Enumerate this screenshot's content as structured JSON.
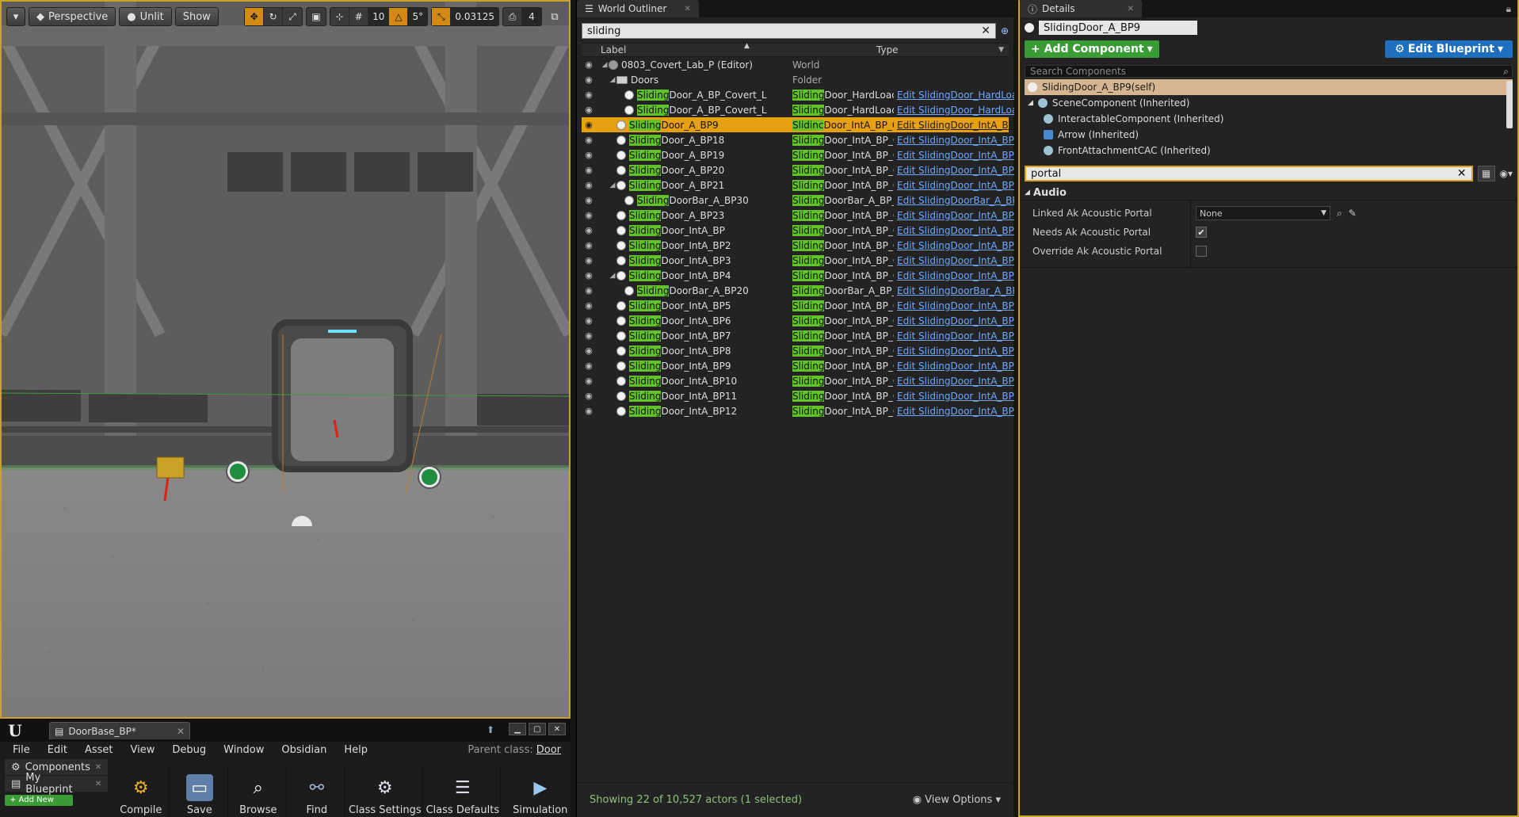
{
  "viewport": {
    "toolbar": {
      "view_mode": "Perspective",
      "lighting": "Unlit",
      "show": "Show",
      "grid_snap": "10",
      "rot_snap": "5°",
      "scale_snap": "0.03125",
      "cam_speed": "4"
    },
    "accent": "#d38a12"
  },
  "bp_editor": {
    "tab_title": "DoorBase_BP*",
    "menu": [
      "File",
      "Edit",
      "Asset",
      "View",
      "Debug",
      "Window",
      "Obsidian",
      "Help"
    ],
    "parent_class_label": "Parent class:",
    "parent_class_value": "Door",
    "left_panels": [
      "Components",
      "My Blueprint"
    ],
    "add_new": "+ Add New",
    "toolbar": [
      "Compile",
      "Save",
      "Browse",
      "Find",
      "Class Settings",
      "Class Defaults",
      "Simulation"
    ]
  },
  "outliner": {
    "tab": "World Outliner",
    "search": "sliding",
    "col_label": "Label",
    "col_type": "Type",
    "footer": "Showing 22 of 10,527 actors (1 selected)",
    "view_options": "View Options",
    "highlight": "#62c22a",
    "rows": [
      {
        "indent": 0,
        "tri": "◢",
        "icon": "world",
        "pre": "",
        "hl": "",
        "post": "0803_Covert_Lab_P (Editor)",
        "t_hl": "",
        "t_post": "",
        "type_plain": "World",
        "edit": ""
      },
      {
        "indent": 1,
        "tri": "◢",
        "icon": "folder",
        "pre": "",
        "hl": "",
        "post": "Doors",
        "t_hl": "",
        "t_post": "",
        "type_plain": "Folder",
        "edit": ""
      },
      {
        "indent": 2,
        "tri": "",
        "icon": "actor",
        "pre": "",
        "hl": "Sliding",
        "post": "Door_A_BP_Covert_L",
        "t_hl": "Sliding",
        "t_post": "Door_HardLoad_BP_C",
        "type_plain": "",
        "edit": "Edit SlidingDoor_HardLoa"
      },
      {
        "indent": 2,
        "tri": "",
        "icon": "actor",
        "pre": "",
        "hl": "Sliding",
        "post": "Door_A_BP_Covert_L",
        "t_hl": "Sliding",
        "t_post": "Door_HardLoad_BP_C",
        "type_plain": "",
        "edit": "Edit SlidingDoor_HardLoa"
      },
      {
        "indent": 1,
        "tri": "",
        "icon": "actor",
        "pre": "",
        "hl": "Sliding",
        "post": "Door_A_BP9",
        "t_hl": "Slidinc",
        "t_post": "Door_IntA_BP_C",
        "type_plain": "",
        "edit": "Edit SlidingDoor_IntA_BP",
        "selected": true
      },
      {
        "indent": 1,
        "tri": "",
        "icon": "actor",
        "pre": "",
        "hl": "Sliding",
        "post": "Door_A_BP18",
        "t_hl": "Sliding",
        "t_post": "Door_IntA_BP_C",
        "type_plain": "",
        "edit": "Edit SlidingDoor_IntA_BP"
      },
      {
        "indent": 1,
        "tri": "",
        "icon": "actor",
        "pre": "",
        "hl": "Sliding",
        "post": "Door_A_BP19",
        "t_hl": "Sliding",
        "t_post": "Door_IntA_BP_C",
        "type_plain": "",
        "edit": "Edit SlidingDoor_IntA_BP"
      },
      {
        "indent": 1,
        "tri": "",
        "icon": "actor",
        "pre": "",
        "hl": "Sliding",
        "post": "Door_A_BP20",
        "t_hl": "Sliding",
        "t_post": "Door_IntA_BP_C",
        "type_plain": "",
        "edit": "Edit SlidingDoor_IntA_BP"
      },
      {
        "indent": 1,
        "tri": "◢",
        "icon": "actor",
        "pre": "",
        "hl": "Sliding",
        "post": "Door_A_BP21",
        "t_hl": "Sliding",
        "t_post": "Door_IntA_BP_C",
        "type_plain": "",
        "edit": "Edit SlidingDoor_IntA_BP"
      },
      {
        "indent": 2,
        "tri": "",
        "icon": "actor",
        "pre": "",
        "hl": "Sliding",
        "post": "DoorBar_A_BP30",
        "t_hl": "Sliding",
        "t_post": "DoorBar_A_BP_C",
        "type_plain": "",
        "edit": "Edit SlidingDoorBar_A_BP"
      },
      {
        "indent": 1,
        "tri": "",
        "icon": "actor",
        "pre": "",
        "hl": "Sliding",
        "post": "Door_A_BP23",
        "t_hl": "Sliding",
        "t_post": "Door_IntA_BP_C",
        "type_plain": "",
        "edit": "Edit SlidingDoor_IntA_BP"
      },
      {
        "indent": 1,
        "tri": "",
        "icon": "actor",
        "pre": "",
        "hl": "Sliding",
        "post": "Door_IntA_BP",
        "t_hl": "Sliding",
        "t_post": "Door_IntA_BP_C",
        "type_plain": "",
        "edit": "Edit SlidingDoor_IntA_BP"
      },
      {
        "indent": 1,
        "tri": "",
        "icon": "actor",
        "pre": "",
        "hl": "Sliding",
        "post": "Door_IntA_BP2",
        "t_hl": "Sliding",
        "t_post": "Door_IntA_BP_C",
        "type_plain": "",
        "edit": "Edit SlidingDoor_IntA_BP"
      },
      {
        "indent": 1,
        "tri": "",
        "icon": "actor",
        "pre": "",
        "hl": "Sliding",
        "post": "Door_IntA_BP3",
        "t_hl": "Sliding",
        "t_post": "Door_IntA_BP_C",
        "type_plain": "",
        "edit": "Edit SlidingDoor_IntA_BP"
      },
      {
        "indent": 1,
        "tri": "◢",
        "icon": "actor",
        "pre": "",
        "hl": "Sliding",
        "post": "Door_IntA_BP4",
        "t_hl": "Sliding",
        "t_post": "Door_IntA_BP_C",
        "type_plain": "",
        "edit": "Edit SlidingDoor_IntA_BP"
      },
      {
        "indent": 2,
        "tri": "",
        "icon": "actor",
        "pre": "",
        "hl": "Sliding",
        "post": "DoorBar_A_BP20",
        "t_hl": "Sliding",
        "t_post": "DoorBar_A_BP_C",
        "type_plain": "",
        "edit": "Edit SlidingDoorBar_A_BP"
      },
      {
        "indent": 1,
        "tri": "",
        "icon": "actor",
        "pre": "",
        "hl": "Sliding",
        "post": "Door_IntA_BP5",
        "t_hl": "Sliding",
        "t_post": "Door_IntA_BP_C",
        "type_plain": "",
        "edit": "Edit SlidingDoor_IntA_BP"
      },
      {
        "indent": 1,
        "tri": "",
        "icon": "actor",
        "pre": "",
        "hl": "Sliding",
        "post": "Door_IntA_BP6",
        "t_hl": "Sliding",
        "t_post": "Door_IntA_BP_C",
        "type_plain": "",
        "edit": "Edit SlidingDoor_IntA_BP"
      },
      {
        "indent": 1,
        "tri": "",
        "icon": "actor",
        "pre": "",
        "hl": "Sliding",
        "post": "Door_IntA_BP7",
        "t_hl": "Sliding",
        "t_post": "Door_IntA_BP_C",
        "type_plain": "",
        "edit": "Edit SlidingDoor_IntA_BP"
      },
      {
        "indent": 1,
        "tri": "",
        "icon": "actor",
        "pre": "",
        "hl": "Sliding",
        "post": "Door_IntA_BP8",
        "t_hl": "Sliding",
        "t_post": "Door_IntA_BP_C",
        "type_plain": "",
        "edit": "Edit SlidingDoor_IntA_BP"
      },
      {
        "indent": 1,
        "tri": "",
        "icon": "actor",
        "pre": "",
        "hl": "Sliding",
        "post": "Door_IntA_BP9",
        "t_hl": "Sliding",
        "t_post": "Door_IntA_BP_C",
        "type_plain": "",
        "edit": "Edit SlidingDoor_IntA_BP"
      },
      {
        "indent": 1,
        "tri": "",
        "icon": "actor",
        "pre": "",
        "hl": "Sliding",
        "post": "Door_IntA_BP10",
        "t_hl": "Sliding",
        "t_post": "Door_IntA_BP_C",
        "type_plain": "",
        "edit": "Edit SlidingDoor_IntA_BP"
      },
      {
        "indent": 1,
        "tri": "",
        "icon": "actor",
        "pre": "",
        "hl": "Sliding",
        "post": "Door_IntA_BP11",
        "t_hl": "Sliding",
        "t_post": "Door_IntA_BP_C",
        "type_plain": "",
        "edit": "Edit SlidingDoor_IntA_BP"
      },
      {
        "indent": 1,
        "tri": "",
        "icon": "actor",
        "pre": "",
        "hl": "Sliding",
        "post": "Door_IntA_BP12",
        "t_hl": "Sliding",
        "t_post": "Door_IntA_BP_C",
        "type_plain": "",
        "edit": "Edit SlidingDoor_IntA_BP"
      }
    ]
  },
  "details": {
    "tab": "Details",
    "actor_name": "SlidingDoor_A_BP9",
    "add_component": "+ Add Component",
    "edit_blueprint": "Edit Blueprint",
    "search_components_placeholder": "Search Components",
    "components": [
      {
        "label": "SlidingDoor_A_BP9(self)",
        "self": true,
        "indent": 0,
        "icon": "actor"
      },
      {
        "label": "SceneComponent (Inherited)",
        "indent": 0,
        "tri": "◢",
        "icon": "scene"
      },
      {
        "label": "InteractableComponent (Inherited)",
        "indent": 1,
        "icon": "scene"
      },
      {
        "label": "Arrow (Inherited)",
        "indent": 1,
        "icon": "arrow"
      },
      {
        "label": "FrontAttachmentCAC (Inherited)",
        "indent": 1,
        "icon": "scene"
      }
    ],
    "filter": "portal",
    "category": "Audio",
    "props": {
      "linked_label": "Linked Ak Acoustic Portal",
      "linked_value": "None",
      "needs_label": "Needs Ak Acoustic Portal",
      "needs_value": true,
      "override_label": "Override Ak Acoustic Portal",
      "override_value": false
    }
  }
}
